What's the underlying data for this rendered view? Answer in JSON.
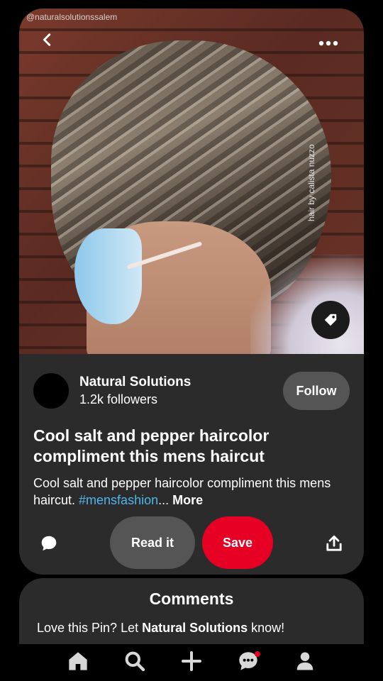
{
  "pin": {
    "watermark": "@naturalsolutionssalem",
    "credit": "hair by calista nuzzo"
  },
  "creator": {
    "name": "Natural Solutions",
    "followers": "1.2k followers",
    "follow_label": "Follow"
  },
  "title": "Cool salt and pepper haircolor compliment this mens haircut",
  "description": {
    "text": "Cool salt and pepper haircolor compliment this mens haircut. ",
    "hashtag": "#mensfashion",
    "ellipsis": "...",
    "more": "More"
  },
  "actions": {
    "read_label": "Read it",
    "save_label": "Save"
  },
  "comments": {
    "heading": "Comments",
    "prompt_prefix": "Love this Pin? Let ",
    "prompt_name": "Natural Solutions",
    "prompt_suffix": " know!"
  },
  "colors": {
    "save": "#e60023",
    "hashtag": "#4fb6ea",
    "card": "#2b2b2b"
  },
  "nav": {
    "items": [
      "home-icon",
      "search-icon",
      "plus-icon",
      "chat-icon",
      "profile-icon"
    ]
  }
}
